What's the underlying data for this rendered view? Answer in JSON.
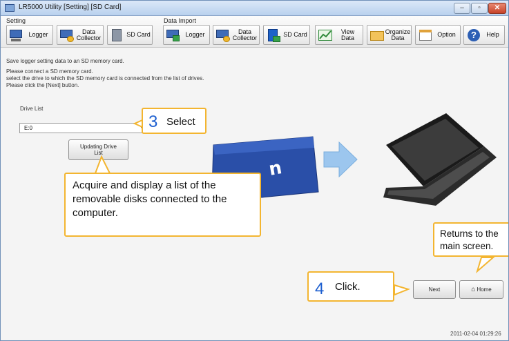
{
  "window": {
    "title": "LR5000 Utility [Setting] [SD Card]",
    "minimize_glyph": "–",
    "maximize_glyph": "▫",
    "close_glyph": "✕"
  },
  "toolbar": {
    "setting_group_label": "Setting",
    "data_import_group_label": "Data Import",
    "setting_buttons": [
      {
        "label": "Logger",
        "icon": "logger-icon"
      },
      {
        "label": "Data\nCollector",
        "icon": "data-collector-icon"
      },
      {
        "label": "SD Card",
        "icon": "sd-card-icon"
      }
    ],
    "import_buttons": [
      {
        "label": "Logger",
        "icon": "logger-import-icon"
      },
      {
        "label": "Data\nCollector",
        "icon": "data-collector-import-icon"
      },
      {
        "label": "SD Card",
        "icon": "sd-card-import-icon"
      }
    ],
    "view_data_label": "View\nData",
    "organize_data_label": "Organize\nData",
    "option_label": "Option",
    "help_label": "Help"
  },
  "main": {
    "instruction_1": "Save logger setting data to an SD memory card.",
    "instruction_2": "Please connect a SD memory card.",
    "instruction_3": "select the drive to which the SD memory card is connected from the list of drives.",
    "instruction_4": "Please click the [Next] button.",
    "drive_list_label": "Drive List",
    "drive_value": "E:0",
    "update_button_label": "Updating Drive\nList",
    "next_button_label": "Next",
    "home_button_label": "Home",
    "timestamp": "2011-02-04 01:29:26"
  },
  "callouts": {
    "select_number": "3",
    "select_text": "Select",
    "acquire_text": "Acquire and display a list of the removable disks connected to the computer.",
    "returns_text": "Returns to the\nmain screen.",
    "click_number": "4",
    "click_text": "Click."
  },
  "colors": {
    "callout_border": "#f3b530",
    "callout_number": "#1d5fd0",
    "sd_card": "#2a4fa8",
    "arrow": "#9cc6ee"
  }
}
